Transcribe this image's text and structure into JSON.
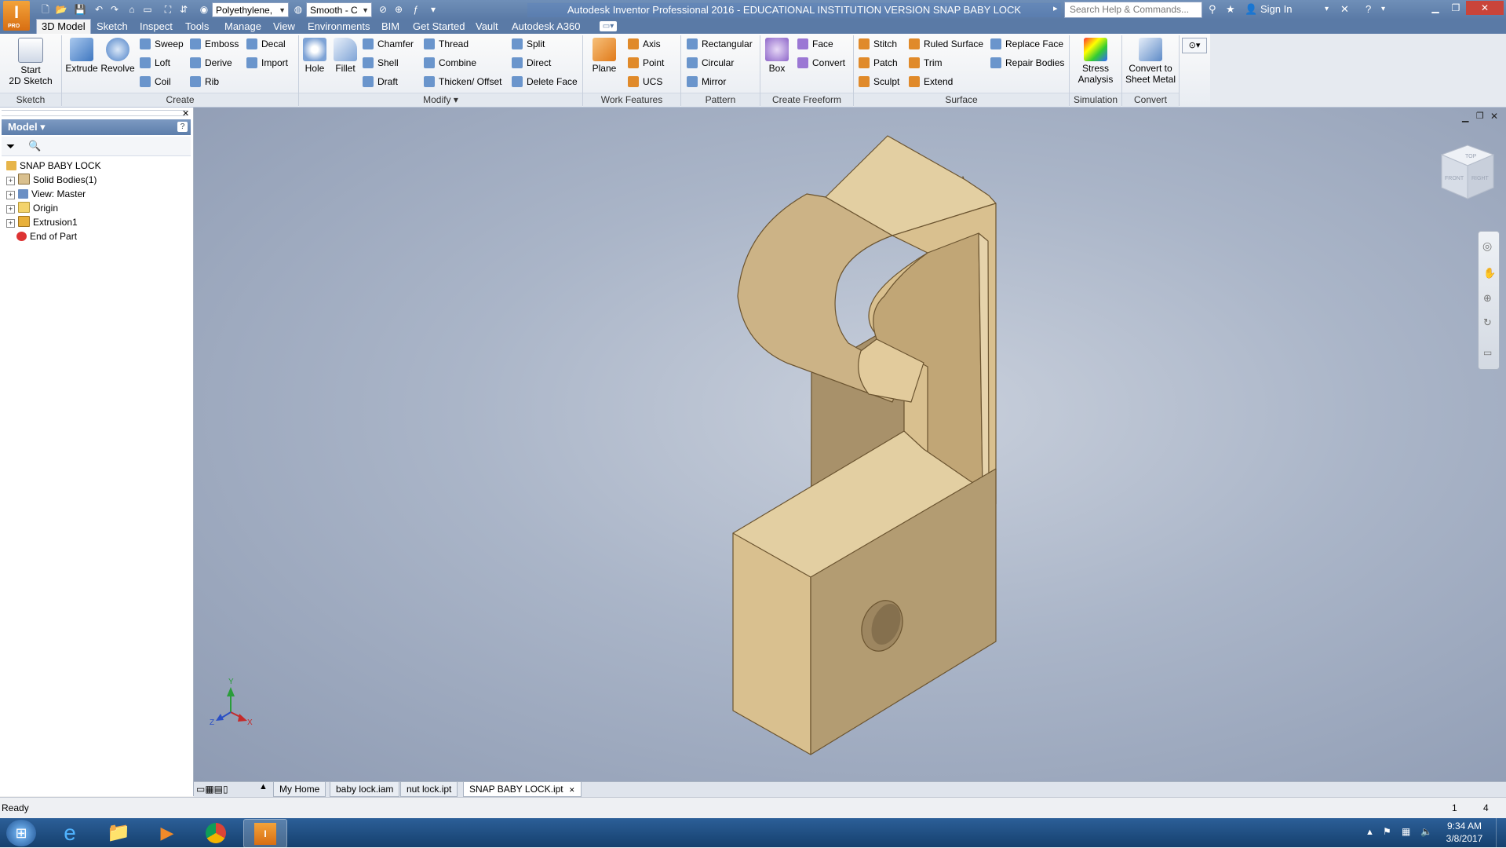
{
  "window": {
    "title": "Autodesk Inventor Professional 2016 - EDUCATIONAL INSTITUTION VERSION    SNAP BABY LOCK",
    "logo_letter": "I",
    "logo_sub": "PRO",
    "material": "Polyethylene,",
    "visual_style": "Smooth - C",
    "search_placeholder": "Search Help & Commands...",
    "sign_in": "Sign In"
  },
  "ribbon": {
    "tabs": [
      "3D Model",
      "Sketch",
      "Inspect",
      "Tools",
      "Manage",
      "View",
      "Environments",
      "BIM",
      "Get Started",
      "Vault",
      "Autodesk A360"
    ],
    "active_tab": "3D Model",
    "groups": {
      "sketch": {
        "label": "Sketch",
        "start_sketch": "Start\n2D Sketch"
      },
      "create": {
        "label": "Create",
        "extrude": "Extrude",
        "revolve": "Revolve",
        "sweep": "Sweep",
        "loft": "Loft",
        "coil": "Coil",
        "emboss": "Emboss",
        "derive": "Derive",
        "rib": "Rib",
        "decal": "Decal",
        "import": "Import"
      },
      "modify": {
        "label": "Modify ▾",
        "hole": "Hole",
        "fillet": "Fillet",
        "chamfer": "Chamfer",
        "shell": "Shell",
        "draft": "Draft",
        "thread": "Thread",
        "combine": "Combine",
        "thicken": "Thicken/ Offset",
        "split": "Split",
        "direct": "Direct",
        "delete_face": "Delete Face"
      },
      "work_features": {
        "label": "Work Features",
        "plane": "Plane",
        "axis": "Axis",
        "point": "Point",
        "ucs": "UCS"
      },
      "pattern": {
        "label": "Pattern",
        "rectangular": "Rectangular",
        "circular": "Circular",
        "mirror": "Mirror"
      },
      "freeform": {
        "label": "Create Freeform",
        "box": "Box",
        "face": "Face",
        "convert": "Convert"
      },
      "surface": {
        "label": "Surface",
        "stitch": "Stitch",
        "patch": "Patch",
        "sculpt": "Sculpt",
        "ruled_surface": "Ruled Surface",
        "trim": "Trim",
        "extend": "Extend",
        "replace_face": "Replace Face",
        "repair_bodies": "Repair Bodies"
      },
      "simulation": {
        "label": "Simulation",
        "stress": "Stress\nAnalysis"
      },
      "convert": {
        "label": "Convert",
        "sheet_metal": "Convert to\nSheet Metal"
      }
    }
  },
  "browser": {
    "title": "Model ▾",
    "tree": [
      {
        "label": "SNAP BABY LOCK",
        "icon": "part-icon",
        "expandable": false
      },
      {
        "label": "Solid Bodies(1)",
        "icon": "solid-bodies-icon",
        "expandable": true
      },
      {
        "label": "View: Master",
        "icon": "view-icon",
        "expandable": true
      },
      {
        "label": "Origin",
        "icon": "folder-icon",
        "expandable": true
      },
      {
        "label": "Extrusion1",
        "icon": "extrusion-icon",
        "expandable": true
      },
      {
        "label": "End of Part",
        "icon": "end-of-part-icon",
        "expandable": false
      }
    ]
  },
  "viewcube": {
    "top": "TOP",
    "front": "FRONT",
    "right": "RIGHT"
  },
  "triad": {
    "x": "X",
    "y": "Y",
    "z": "Z"
  },
  "doc_tabs": [
    "My Home",
    "baby lock.iam",
    "nut lock.ipt",
    "SNAP BABY LOCK.ipt"
  ],
  "active_doc": "SNAP BABY LOCK.ipt",
  "status": {
    "text": "Ready",
    "count1": "1",
    "count2": "4"
  },
  "taskbar": {
    "time": "9:34 AM",
    "date": "3/8/2017"
  },
  "colors": {
    "part_face_light": "#e8d3a6",
    "part_face_mid": "#d9c08f",
    "part_face_dark": "#b79e6e",
    "title_bar": "#5a7aa6",
    "accent_orange": "#e8862a"
  }
}
